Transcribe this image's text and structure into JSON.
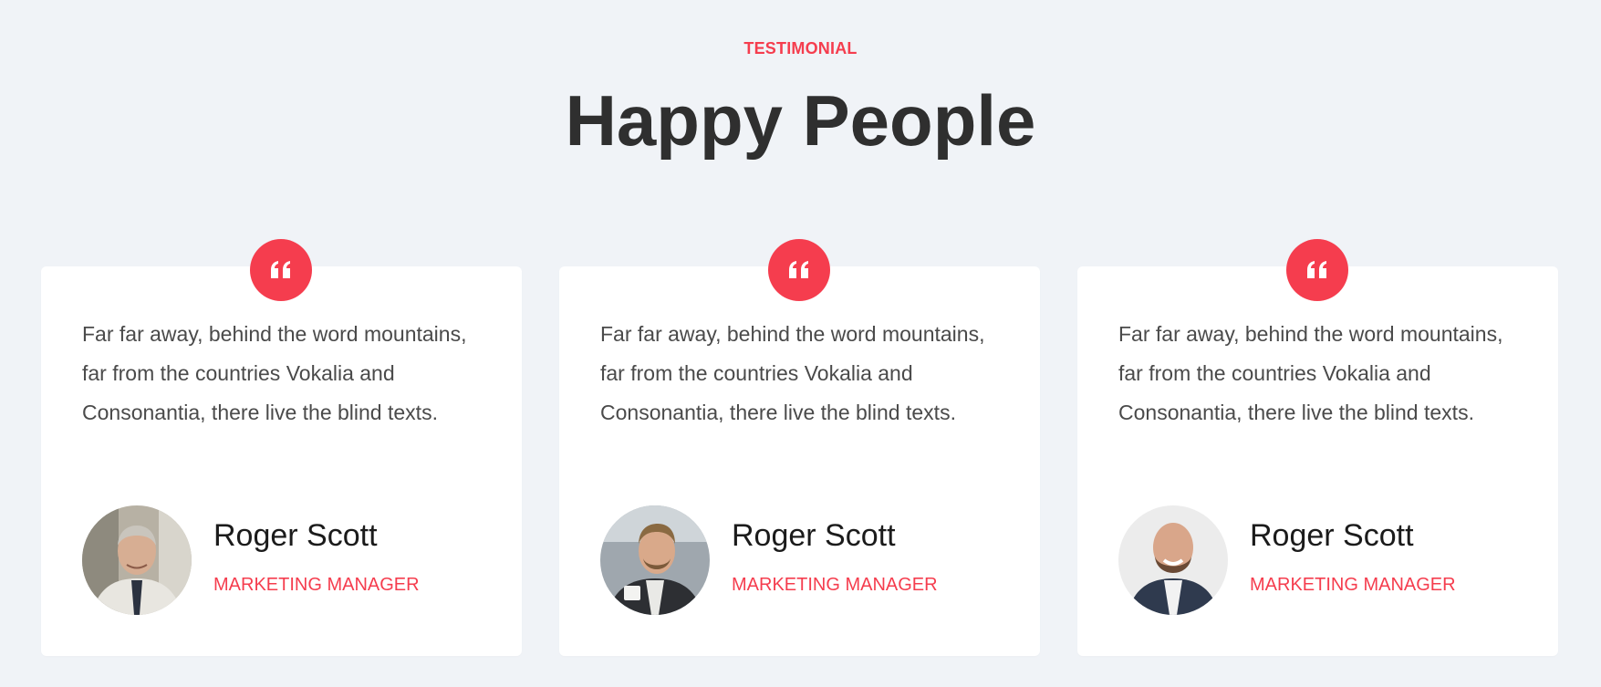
{
  "section": {
    "eyebrow": "TESTIMONIAL",
    "title": "Happy People"
  },
  "colors": {
    "accent": "#f53d4e",
    "background": "#f0f3f7",
    "card": "#ffffff",
    "heading": "#2f2f2f"
  },
  "testimonials": [
    {
      "icon": "quote-icon",
      "text": "Far far away, behind the word mountains, far from the countries Vokalia and Consonantia, there live the blind texts.",
      "name": "Roger Scott",
      "role": "MARKETING MANAGER",
      "avatar": "avatar-older-man-photo"
    },
    {
      "icon": "quote-icon",
      "text": "Far far away, behind the word mountains, far from the countries Vokalia and Consonantia, there live the blind texts.",
      "name": "Roger Scott",
      "role": "MARKETING MANAGER",
      "avatar": "avatar-man-with-coffee-photo"
    },
    {
      "icon": "quote-icon",
      "text": "Far far away, behind the word mountains, far from the countries Vokalia and Consonantia, there live the blind texts.",
      "name": "Roger Scott",
      "role": "MARKETING MANAGER",
      "avatar": "avatar-bald-man-photo"
    }
  ]
}
